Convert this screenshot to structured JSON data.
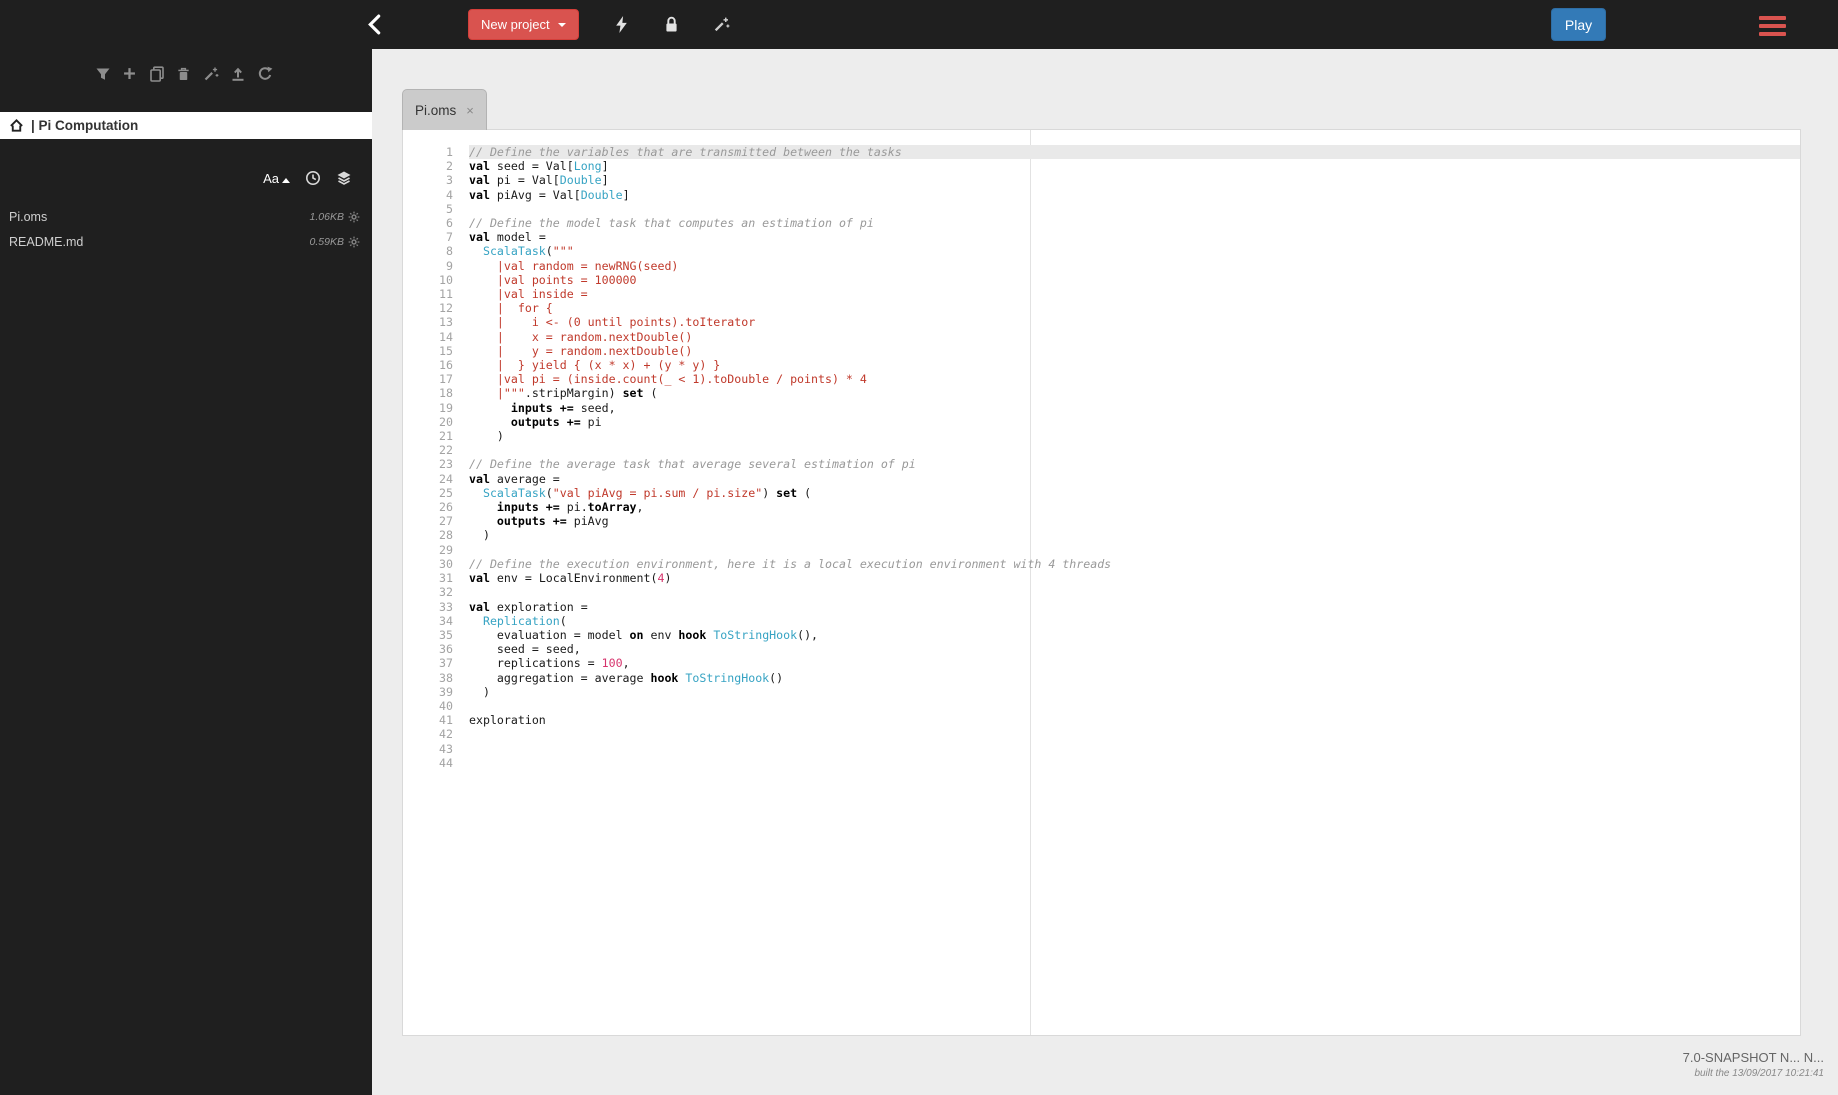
{
  "topbar": {
    "back_icon": "chevron-left",
    "new_project_label": "New project",
    "tool_icons": [
      "lightning-icon",
      "lock-icon",
      "magic-wand-icon"
    ],
    "play_label": "Play",
    "menu_icon": "hamburger-menu",
    "accent_danger": "#d9534f",
    "accent_primary": "#337ab7"
  },
  "sidebar": {
    "toolbar_icons": [
      "filter-icon",
      "add-icon",
      "copy-icon",
      "trash-icon",
      "wand-icon",
      "upload-icon",
      "refresh-icon"
    ],
    "home_icon": "home",
    "project_title": "| Pi Computation",
    "sort": {
      "alpha_label": "Aa",
      "time_icon": "clock",
      "size_icon": "layers"
    },
    "files": [
      {
        "name": "Pi.oms",
        "size": "1.06KB"
      },
      {
        "name": "README.md",
        "size": "0.59KB"
      }
    ]
  },
  "editor": {
    "tab_label": "Pi.oms",
    "tab_close_label": "×",
    "active_line": 1,
    "lines": [
      [
        [
          "c",
          "// Define the variables that are transmitted between the tasks"
        ]
      ],
      [
        [
          "k",
          "val"
        ],
        [
          "d",
          " seed = Val["
        ],
        [
          "t",
          "Long"
        ],
        [
          "d",
          "]"
        ]
      ],
      [
        [
          "k",
          "val"
        ],
        [
          "d",
          " pi = Val["
        ],
        [
          "t",
          "Double"
        ],
        [
          "d",
          "]"
        ]
      ],
      [
        [
          "k",
          "val"
        ],
        [
          "d",
          " piAvg = Val["
        ],
        [
          "t",
          "Double"
        ],
        [
          "d",
          "]"
        ]
      ],
      [],
      [
        [
          "c",
          "// Define the model task that computes an estimation of pi"
        ]
      ],
      [
        [
          "k",
          "val"
        ],
        [
          "d",
          " model ="
        ]
      ],
      [
        [
          "d",
          "  "
        ],
        [
          "t",
          "ScalaTask"
        ],
        [
          "d",
          "("
        ],
        [
          "s",
          "\"\"\""
        ]
      ],
      [
        [
          "s",
          "    |val random = newRNG(seed)"
        ]
      ],
      [
        [
          "s",
          "    |val points = 100000"
        ]
      ],
      [
        [
          "s",
          "    |val inside ="
        ]
      ],
      [
        [
          "s",
          "    |  for {"
        ]
      ],
      [
        [
          "s",
          "    |    i <- (0 until points).toIterator"
        ]
      ],
      [
        [
          "s",
          "    |    x = random.nextDouble()"
        ]
      ],
      [
        [
          "s",
          "    |    y = random.nextDouble()"
        ]
      ],
      [
        [
          "s",
          "    |  } yield { (x * x) + (y * y) }"
        ]
      ],
      [
        [
          "s",
          "    |val pi = (inside.count(_ < 1).toDouble / points) * 4"
        ]
      ],
      [
        [
          "s",
          "    |\"\"\""
        ],
        [
          "d",
          ".stripMargin) "
        ],
        [
          "k",
          "set"
        ],
        [
          "d",
          " ("
        ]
      ],
      [
        [
          "d",
          "      "
        ],
        [
          "k",
          "inputs +="
        ],
        [
          "d",
          " seed,"
        ]
      ],
      [
        [
          "d",
          "      "
        ],
        [
          "k",
          "outputs +="
        ],
        [
          "d",
          " pi"
        ]
      ],
      [
        [
          "d",
          "    )"
        ]
      ],
      [],
      [
        [
          "c",
          "// Define the average task that average several estimation of pi"
        ]
      ],
      [
        [
          "k",
          "val"
        ],
        [
          "d",
          " average ="
        ]
      ],
      [
        [
          "d",
          "  "
        ],
        [
          "t",
          "ScalaTask"
        ],
        [
          "d",
          "("
        ],
        [
          "s",
          "\"val piAvg = pi.sum / pi.size\""
        ],
        [
          "d",
          ") "
        ],
        [
          "k",
          "set"
        ],
        [
          "d",
          " ("
        ]
      ],
      [
        [
          "d",
          "    "
        ],
        [
          "k",
          "inputs +="
        ],
        [
          "d",
          " pi."
        ],
        [
          "k",
          "toArray"
        ],
        [
          "d",
          ","
        ]
      ],
      [
        [
          "d",
          "    "
        ],
        [
          "k",
          "outputs +="
        ],
        [
          "d",
          " piAvg"
        ]
      ],
      [
        [
          "d",
          "  )"
        ]
      ],
      [],
      [
        [
          "c",
          "// Define the execution environment, here it is a local execution environment with 4 threads"
        ]
      ],
      [
        [
          "k",
          "val"
        ],
        [
          "d",
          " env = LocalEnvironment("
        ],
        [
          "n",
          "4"
        ],
        [
          "d",
          ")"
        ]
      ],
      [],
      [
        [
          "k",
          "val"
        ],
        [
          "d",
          " exploration ="
        ]
      ],
      [
        [
          "d",
          "  "
        ],
        [
          "t",
          "Replication"
        ],
        [
          "d",
          "("
        ]
      ],
      [
        [
          "d",
          "    evaluation = model "
        ],
        [
          "k",
          "on"
        ],
        [
          "d",
          " env "
        ],
        [
          "k",
          "hook"
        ],
        [
          "d",
          " "
        ],
        [
          "t",
          "ToStringHook"
        ],
        [
          "d",
          "(),"
        ]
      ],
      [
        [
          "d",
          "    seed = seed,"
        ]
      ],
      [
        [
          "d",
          "    replications = "
        ],
        [
          "n",
          "100"
        ],
        [
          "d",
          ","
        ]
      ],
      [
        [
          "d",
          "    aggregation = average "
        ],
        [
          "k",
          "hook"
        ],
        [
          "d",
          " "
        ],
        [
          "t",
          "ToStringHook"
        ],
        [
          "d",
          "()"
        ]
      ],
      [
        [
          "d",
          "  )"
        ]
      ],
      [],
      [
        [
          "d",
          "exploration"
        ]
      ],
      [],
      [],
      []
    ]
  },
  "footer": {
    "version": "7.0-SNAPSHOT N... N...",
    "built": "built the 13/09/2017 10:21:41"
  }
}
